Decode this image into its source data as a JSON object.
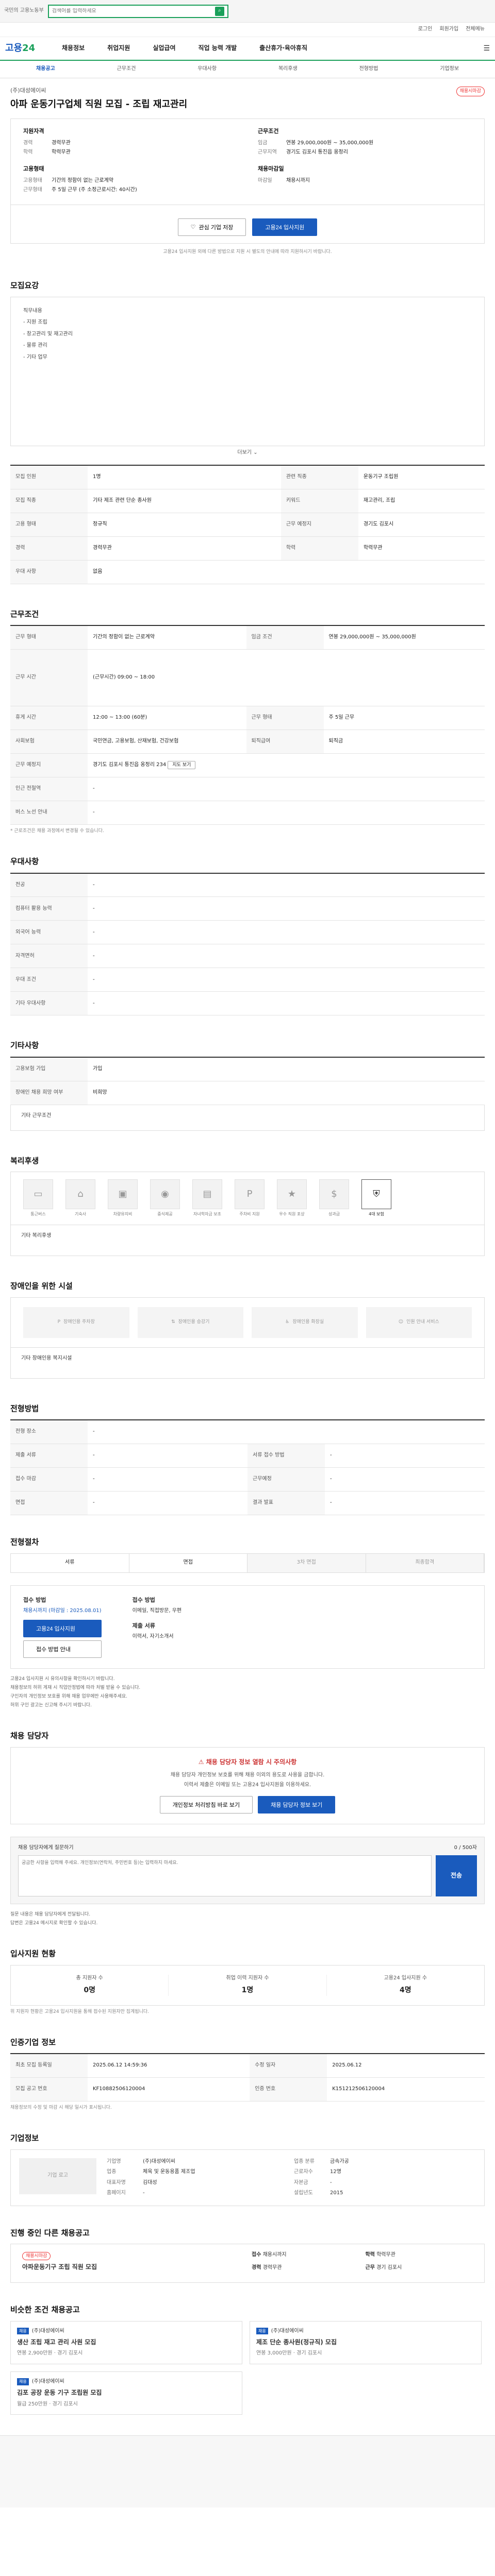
{
  "topbar": {
    "notice": "국민의 고용노동부",
    "search_placeholder": "검색어를 입력하세요"
  },
  "utility": [
    "로그인",
    "회원가입",
    "전체메뉴"
  ],
  "gnb": {
    "logo_a": "고용",
    "logo_b": "24",
    "menu": [
      "채용정보",
      "취업지원",
      "실업급여",
      "직업 능력 개발",
      "출산휴가·육아휴직"
    ],
    "allmenu": "☰"
  },
  "tabs": [
    "채용공고",
    "근무조건",
    "우대사항",
    "복리후생",
    "전형방법",
    "기업정보"
  ],
  "company": {
    "name": "(주)대성에이씨",
    "title": "아파 운동기구업체 직원 모집 - 조립 재고관리",
    "badge": "채용시마감"
  },
  "summary": {
    "col1_h": "지원자격",
    "col1": [
      [
        "경력",
        "경력무관"
      ],
      [
        "학력",
        "학력무관"
      ]
    ],
    "col1_h2": "고용형태",
    "col1b": [
      [
        "고용형태",
        "기간의 정함이 없는 근로계약"
      ],
      [
        "근무형태",
        "주 5일 근무 (주 소정근로시간: 40시간)"
      ]
    ],
    "col2_h": "근무조건",
    "col2": [
      [
        "임금",
        "연봉 29,000,000원 ~ 35,000,000원"
      ],
      [
        "근무지역",
        "경기도 김포시 통진읍 옹정리"
      ]
    ],
    "col2_h2": "채용마감일",
    "col2b": [
      [
        "마감일",
        "채용시까지"
      ]
    ]
  },
  "actions": {
    "scrap": "관심 기업 저장",
    "apply": "고용24 입사지원"
  },
  "disclaim": "고용24 입사지원 외에 다른 방법으로 지원 시 별도의 안내에 따라 지원하시기 바랍니다.",
  "sections": {
    "job": "모집요강",
    "cond": "근무조건",
    "pref": "우대사항",
    "etc": "기타사항",
    "welfare": "복리후생",
    "disabled": "장애인을 위한 시설",
    "process": "전형방법",
    "contact": "채용 담당자",
    "stats": "입사지원 현황",
    "history": "인증기업 정보",
    "bizinfo": "기업정보",
    "others": "진행 중인 다른 채용공고",
    "similar": "비슷한 조건 채용공고"
  },
  "job_text": [
    "직무내용",
    "- 지원 조립",
    "- 창고관리 및 재고관리",
    "- 물류 관리",
    "- 기타 업무"
  ],
  "more": "더보기",
  "job_table": [
    [
      "모집 인원",
      "1명",
      "관련 직종",
      "운동기구 조립원"
    ],
    [
      "모집 직종",
      "기타 제조 관련 단순 종사원",
      "키워드",
      "재고관리, 조립"
    ],
    [
      "고용 형태",
      "정규직",
      "근무 예정지",
      "경기도 김포시"
    ],
    [
      "경력",
      "경력무관",
      "학력",
      "학력무관"
    ],
    [
      "우대 사항",
      "없음",
      "",
      ""
    ]
  ],
  "cond_table": [
    [
      "근무 형태",
      "기간의 정함이 없는 근로계약",
      "임금 조건",
      "연봉 29,000,000원 ~ 35,000,000원"
    ],
    [
      "근무 시간",
      "(근무시간) 09:00 ~ 18:00",
      "",
      ""
    ],
    [
      "휴게 시간",
      "12:00 ~ 13:00 (60분)",
      "근무 형태",
      "주 5일 근무"
    ],
    [
      "사회보험",
      "국민연금, 고용보험, 산재보험, 건강보험",
      "퇴직급여",
      "퇴직금"
    ],
    [
      "근무 예정지",
      "경기도 김포시 통진읍 옹정리 234",
      "",
      ""
    ],
    [
      "인근 전철역",
      "-",
      "",
      ""
    ],
    [
      "버스 노선 안내",
      "-",
      "",
      ""
    ]
  ],
  "pref_table": [
    [
      "전공",
      "-"
    ],
    [
      "컴퓨터 활용 능력",
      "-"
    ],
    [
      "외국어 능력",
      "-"
    ],
    [
      "자격면허",
      "-"
    ],
    [
      "우대 조건",
      "-"
    ],
    [
      "기타 우대사항",
      "-"
    ]
  ],
  "etc_table": [
    [
      "고용보험 가입",
      "가입"
    ],
    [
      "장애인 채용 희망 여부",
      "비희망"
    ]
  ],
  "welfare_items": [
    "통근버스",
    "기숙사",
    "차량유지비",
    "중식제공",
    "자녀학자금 보조",
    "주차비 지원",
    "우수 직원 포상",
    "성과급",
    "4대 보험"
  ],
  "welfare_other": "기타 복리후생",
  "disabled_items": [
    "장애인용 주차장",
    "장애인용 승강기",
    "장애인용 화장실",
    "인원 안내 서비스"
  ],
  "disabled_other": "기타 장애인용 복지시설",
  "process_table": [
    [
      "전형 장소",
      "-"
    ],
    [
      "제출 서류",
      "-",
      "서류 접수 방법",
      "-"
    ],
    [
      "접수 마감",
      "-",
      "근무예정",
      "-"
    ],
    [
      "면접",
      "-",
      "결과 발표",
      "-"
    ]
  ],
  "procbar": [
    "서류",
    "면접",
    "3차 면접",
    "최종합격"
  ],
  "apply": {
    "h1": "접수 방법",
    "v1": "채용시까지 (마감일 : 2025.08.01)",
    "h2": "접수 방법",
    "v2": "이메일, 직접방문, 우편",
    "btn1": "고용24 입사지원",
    "btn2": "접수 방법 안내",
    "h3": "제출 서류",
    "v3": "이력서, 자기소개서"
  },
  "bullets": [
    "고용24 입사지원 시 유의사항을 확인하시기 바랍니다.",
    "채용정보의 허위 게재 시 직업안정법에 따라 처벌 받을 수 있습니다.",
    "구인자의 개인정보 보호를 위해 채용 업무에만 사용해주세요.",
    "허위 구인 광고는 신고해 주시기 바랍니다."
  ],
  "contact": {
    "head": "채용 담당자 정보 열람 시 주의사항",
    "l1": "채용 담당자 개인정보 보호를 위해 채용 이외의 용도로 사용을 금합니다.",
    "l2": "이력서 제출은 이메일 또는 고용24 입사지원을 이용하세요.",
    "b1": "개인정보 처리방침 바로 보기",
    "b2": "채용 담당자 정보 보기"
  },
  "inquiry": {
    "h": "채용 담당자에게 질문하기",
    "count": "0 / 500자",
    "placeholder": "궁금한 사항을 입력해 주세요. 개인정보(연락처, 주민번호 등)는 입력하지 마세요.",
    "send": "전송"
  },
  "inq_notes": [
    "질문 내용은 채용 담당자에게 전달됩니다.",
    "답변은 고용24 메시지로 확인할 수 있습니다."
  ],
  "stats": [
    [
      "총 지원자 수",
      "0명"
    ],
    [
      "취업 이력 지원자 수",
      "1명"
    ],
    [
      "고용24 입사지원 수",
      "4명"
    ]
  ],
  "stats_note": "위 지원자 현황은 고용24 입사지원을 통해 접수된 지원자만 집계됩니다.",
  "history_table": [
    [
      "최초 모집 등록일",
      "2025.06.12 14:59:36",
      "수정 일자",
      "2025.06.12"
    ],
    [
      "모집 공고 번호",
      "KF10882506120004",
      "인증 번호",
      "K151212506120004"
    ]
  ],
  "history_note": "채용정보의 수정 및 마감 시 해당 일시가 표시됩니다.",
  "biz": {
    "logo": "기업 로고",
    "rows": [
      [
        "기업명",
        "(주)대성에이씨",
        "업종 분류",
        "금속가공"
      ],
      [
        "업종",
        "체육 및 운동용품 제조업",
        "근로자수",
        "12명"
      ],
      [
        "대표자명",
        "김대성",
        "자본금",
        "-"
      ],
      [
        "홈페이지",
        "-",
        "설립년도",
        "2015"
      ]
    ]
  },
  "others_list": {
    "tag": "채용시마감",
    "title": "아파운동기구 조립 직원 모집",
    "r": [
      [
        "접수",
        "채용시까지"
      ],
      [
        "학력",
        "학력무관"
      ],
      [
        "경력",
        "경력무관"
      ],
      [
        "근무",
        "경기 김포시"
      ]
    ]
  },
  "cards": [
    [
      "(주)대성에이씨",
      "생산 조립 재고 관리 사원 모집",
      "연봉 2,900만원 · 경기 김포시"
    ],
    [
      "(주)대성에이씨",
      "제조 단순 종사원(정규직) 모집",
      "연봉 3,000만원 · 경기 김포시"
    ],
    [
      "(주)대성에이씨",
      "김포 공장 운동 기구 조립원 모집",
      "월급 250만원 · 경기 김포시"
    ]
  ]
}
